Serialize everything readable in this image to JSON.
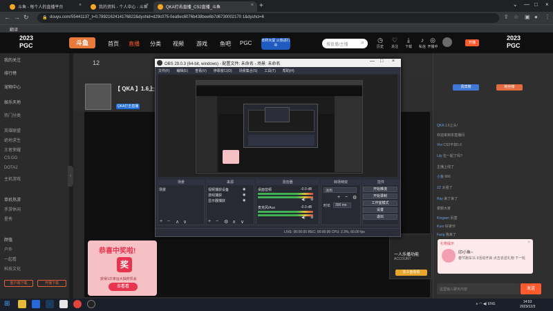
{
  "browser": {
    "tabs": [
      {
        "label": "斗鱼 - 每个人的直播平台"
      },
      {
        "label": "我的资料 - 个人中心 - 斗鱼"
      },
      {
        "label": "QKA打击直播_CS2直播_斗鱼"
      }
    ],
    "url": "douyu.com/55441137_t=0.7892162414176822&dyshid=d29c075-0ea9ec6076b438bee6b7d6730002170 1&dyshci=6",
    "bookmark": "翻译"
  },
  "site": {
    "logo_left": "2023 PGC",
    "logo_right": "2023 PGC",
    "brand": "斗鱼",
    "nav": [
      "首页",
      "直播",
      "分类",
      "视频",
      "游戏",
      "鱼吧",
      "PGC"
    ],
    "active_nav": "直播",
    "promo": "年终大促 火热进行中",
    "search_placeholder": "搜直播/主播",
    "header_icons": [
      {
        "name": "history",
        "label": "历史"
      },
      {
        "name": "follow",
        "label": "关注"
      },
      {
        "name": "download",
        "label": "下载"
      },
      {
        "name": "chat",
        "label": "私信"
      },
      {
        "name": "live",
        "label": "开播中"
      }
    ],
    "open_label": "开播"
  },
  "sidebar": {
    "items": [
      "我的关注",
      "排行榜",
      "宠物中心",
      "娱乐天地",
      "热门分类",
      "英雄联盟",
      "绝地求生",
      "王者荣耀",
      "CS:GO",
      "DOTA2",
      "主机游戏",
      "单机热游",
      "手游休闲",
      "星秀",
      "颜值",
      "户外",
      "一起看",
      "科技文化"
    ],
    "foot_left": "客户端下载",
    "foot_right": "开播下载"
  },
  "room": {
    "stats_num": "12",
    "title": "【 QKA 】1.6上头!",
    "tag": "QKA打击直播"
  },
  "lottery": {
    "heading": "恭喜中奖啦!",
    "big": "奖",
    "sub": "获得1次幸运大抽奖机会",
    "button": "去看看"
  },
  "pip": {
    "title": "一人乐播功能",
    "sub": "ACCOUNT",
    "button": "去斗鱼看看"
  },
  "chat": {
    "top_buttons": [
      "贵宾榜",
      "粉丝榜"
    ],
    "rows": [
      {
        "user": "QKA",
        "text": "1.6上头!"
      },
      {
        "user": "",
        "text": "欢迎来到本直播间"
      },
      {
        "user": "Vivi",
        "text": "CS2不如1.6"
      },
      {
        "user": "Lily",
        "text": "在一起了吗?"
      },
      {
        "user": "",
        "text": "主播上线了"
      },
      {
        "user": "小鱼",
        "text": "666"
      },
      {
        "user": "ZZ",
        "text": "太强了"
      },
      {
        "user": "Ray",
        "text": "来了来了"
      },
      {
        "user": "",
        "text": "谢谢大家"
      },
      {
        "user": "Kingsen",
        "text": "厉害"
      },
      {
        "user": "Kuro",
        "text": "好家伙"
      },
      {
        "user": "Fang",
        "text": "我来了"
      }
    ],
    "gift_title": "礼物提示",
    "gift_line1": "印小鱼~",
    "gift_line2": "春节跑车11.9活动开启 点击去送礼物 下一轮",
    "input_placeholder": "这里输入聊天内容",
    "send": "发送"
  },
  "obs": {
    "title": "OBS 29.0.3 (64-bit, windows) - 配置文件: 未命名 - 场景: 未命名",
    "menu": [
      "文件(F)",
      "编辑(E)",
      "查看(V)",
      "停靠窗口(D)",
      "场景集合(S)",
      "工具(T)",
      "帮助(H)"
    ],
    "docks": {
      "scenes": {
        "title": "场景",
        "items": [
          "场景"
        ]
      },
      "sources": {
        "title": "来源",
        "items": [
          "视频捕获设备",
          "游戏捕获",
          "显示器捕获"
        ]
      },
      "mixer": {
        "title": "混音器",
        "items": [
          {
            "label": "桌面音频",
            "level": "-0.0 dB"
          },
          {
            "label": "麦克风/Aux",
            "level": "-0.0 dB"
          }
        ]
      },
      "transitions": {
        "title": "转场特效",
        "type": "淡出",
        "duration_label": "时长",
        "duration": "300 ms"
      },
      "controls": {
        "title": "控件",
        "buttons": [
          "开始推流",
          "开始录制",
          "工作室模式",
          "设置",
          "退出"
        ]
      }
    },
    "status": "LIVE: 00:00:00   REC: 00:00:00   CPU: 2.3%, 60.00 fps"
  },
  "taskbar": {
    "lang": "ENG",
    "time": "14:53",
    "date": "2023/12/3"
  }
}
